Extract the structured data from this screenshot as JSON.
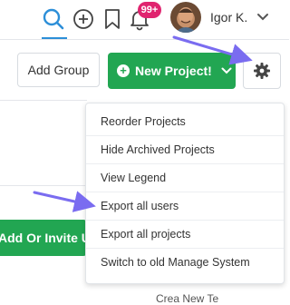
{
  "header": {
    "notification_badge": "99+",
    "user_name": "Igor K.",
    "icons": [
      "search-icon",
      "plus-circle-icon",
      "bookmark-icon",
      "bell-icon",
      "chevron-down-icon"
    ]
  },
  "toolbar": {
    "add_group_label": "Add Group",
    "new_project_label": "New Project!",
    "settings_icon": "gear-icon"
  },
  "settings_menu": {
    "items": [
      "Reorder Projects",
      "Hide Archived Projects",
      "View Legend",
      "Export all users",
      "Export all projects",
      "Switch to old Manage System"
    ]
  },
  "side": {
    "invite_label": "Add Or Invite Us"
  },
  "footer": {
    "partial_text": "Crea       New Te"
  },
  "colors": {
    "accent_blue": "#2d8fd8",
    "primary_green": "#22a652",
    "badge_pink": "#e0246f",
    "annotation_arrow": "#7a6cf0"
  }
}
